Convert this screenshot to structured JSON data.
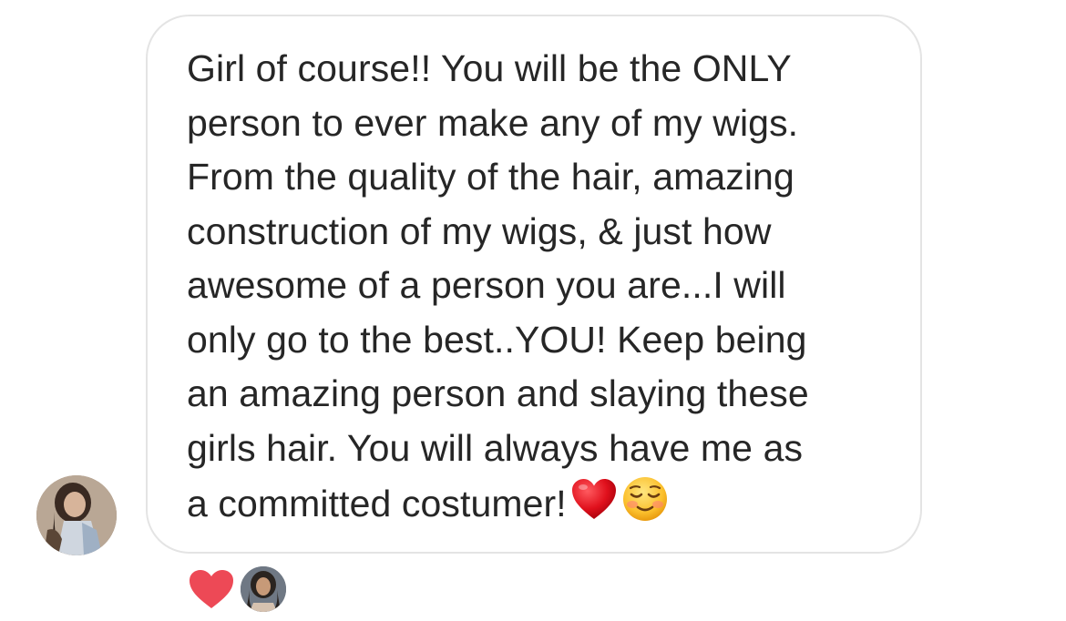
{
  "message": {
    "lines": [
      "Girl of course!! You will be the ONLY",
      "person to ever make any of my wigs.",
      "From the quality of the hair, amazing",
      "construction of my wigs, & just how",
      "awesome of a person you are...I will",
      "only go to the best..YOU! Keep being",
      "an amazing person and slaying these",
      "girls hair. You will always have me as",
      "a committed costumer!"
    ],
    "trailing_emojis": [
      "red-heart-emoji",
      "smiling-face-emoji"
    ]
  },
  "reactions": {
    "icon": "heart-icon",
    "color": "#ed4956"
  },
  "colors": {
    "bubble_border": "#e4e4e4",
    "text": "#262626",
    "background": "#ffffff"
  }
}
